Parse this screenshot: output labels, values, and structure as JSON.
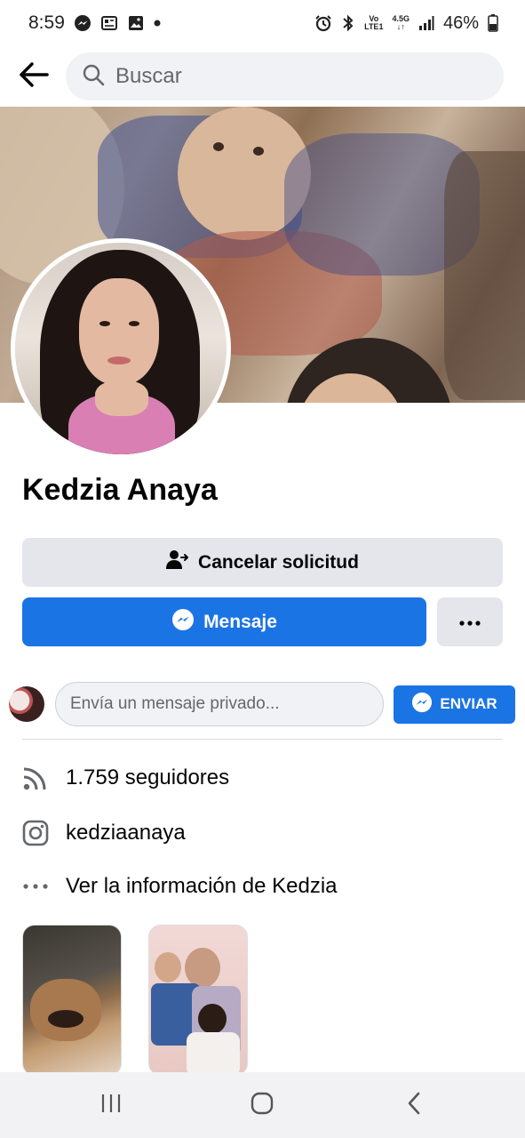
{
  "status_bar": {
    "time": "8:59",
    "battery": "46%",
    "network_top": "Vo",
    "network_bottom": "LTE1",
    "network_speed": "4.5G"
  },
  "search": {
    "placeholder": "Buscar"
  },
  "profile": {
    "name": "Kedzia Anaya"
  },
  "actions": {
    "cancel_request": "Cancelar solicitud",
    "message": "Mensaje"
  },
  "private_message": {
    "placeholder": "Envía un mensaje privado...",
    "send_label": "ENVIAR"
  },
  "info": {
    "followers": "1.759 seguidores",
    "instagram": "kedziaanaya",
    "see_info": "Ver la información de Kedzia"
  },
  "colors": {
    "accent": "#1b74e4",
    "secondary_button": "#e4e6eb",
    "input_bg": "#f0f2f5"
  },
  "icons": {
    "back": "arrow-left-icon",
    "search": "search-icon",
    "cancel_request": "person-arrow-icon",
    "messenger": "messenger-icon",
    "more": "more-dots-icon",
    "followers": "rss-feed-icon",
    "instagram": "instagram-icon",
    "info": "dots-icon"
  }
}
